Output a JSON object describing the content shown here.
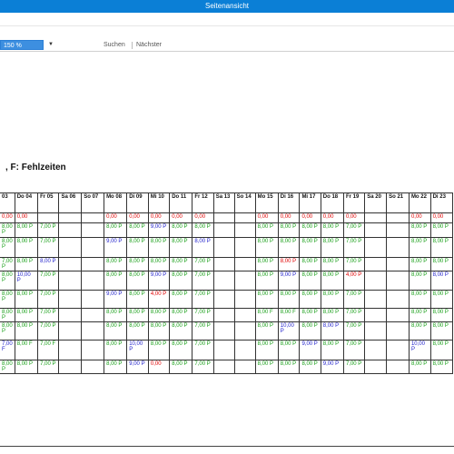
{
  "window": {
    "title": "Seitenansicht"
  },
  "toolbar": {
    "zoom": "150 %",
    "search_label": "Suchen",
    "next_label": "Nächster"
  },
  "report": {
    "heading": ", F: Fehlzeiten"
  },
  "colors": {
    "titlebar": "#0b7fd6",
    "zero": "#e00000",
    "normal": "#159e15",
    "blue": "#2222cc"
  },
  "table": {
    "headers": [
      "03",
      "Do 04",
      "Fr 05",
      "Sa 06",
      "So 07",
      "Mo 08",
      "Di 09",
      "Mi 10",
      "Do 11",
      "Fr 12",
      "Sa 13",
      "So 14",
      "Mo 15",
      "Di 16",
      "Mi 17",
      "Do 18",
      "Fr 19",
      "Sa 20",
      "So 21",
      "Mo 22",
      "Di 23"
    ],
    "rows": [
      [
        "0,00",
        "0,00",
        "",
        "",
        "",
        "0,00",
        "0,00",
        "0,00",
        "0,00",
        "0,00",
        "",
        "",
        "0,00",
        "0,00",
        "0,00",
        "0,00",
        "0,00",
        "",
        "",
        "0,00",
        "0,00"
      ],
      [
        "8,00 P",
        "8,00 P",
        "7,00 P",
        "",
        "",
        "8,00 P",
        "8,00 P",
        "9,00 P",
        "8,00 P",
        "8,00 P",
        "",
        "",
        "8,00 P",
        "8,00 P",
        "8,00 P",
        "8,00 P",
        "7,00 P",
        "",
        "",
        "8,00 P",
        "8,00 P"
      ],
      [
        "8,00 P",
        "8,00 P",
        "7,00 P",
        "",
        "",
        "9,00 P",
        "8,00 P",
        "8,00 P",
        "8,00 P",
        "8,00 P",
        "",
        "",
        "8,00 P",
        "8,00 P",
        "8,00 P",
        "8,00 P",
        "7,00 P",
        "",
        "",
        "8,00 P",
        "8,00 P"
      ],
      [
        "7,00 P",
        "8,00 P",
        "8,00 P",
        "",
        "",
        "8,00 P",
        "8,00 P",
        "8,00 P",
        "8,00 P",
        "7,00 P",
        "",
        "",
        "8,00 P",
        "8,00 P",
        "8,00 P",
        "8,00 P",
        "7,00 P",
        "",
        "",
        "8,00 P",
        "8,00 P"
      ],
      [
        "8,00 P",
        "10,00 P",
        "7,00 P",
        "",
        "",
        "8,00 P",
        "8,00 P",
        "9,00 P",
        "8,00 P",
        "7,00 P",
        "",
        "",
        "8,00 P",
        "9,00 P",
        "8,00 P",
        "8,00 P",
        "4,00 P",
        "",
        "",
        "8,00 P",
        "8,00 P"
      ],
      [
        "8,00 P",
        "8,00 P",
        "7,00 P",
        "",
        "",
        "9,00 P",
        "8,00 P",
        "4,00 P",
        "8,00 P",
        "7,00 P",
        "",
        "",
        "8,00 P",
        "8,00 P",
        "8,00 P",
        "8,00 P",
        "7,00 P",
        "",
        "",
        "8,00 P",
        "8,00 P"
      ],
      [
        "8,00 P",
        "8,00 P",
        "7,00 P",
        "",
        "",
        "8,00 P",
        "8,00 P",
        "8,00 P",
        "8,00 P",
        "7,00 P",
        "",
        "",
        "8,00 F",
        "8,00 F",
        "8,00 P",
        "8,00 P",
        "7,00 P",
        "",
        "",
        "8,00 P",
        "8,00 P"
      ],
      [
        "8,00 P",
        "8,00 P",
        "7,00 P",
        "",
        "",
        "8,00 P",
        "8,00 P",
        "8,00 P",
        "8,00 P",
        "7,00 P",
        "",
        "",
        "8,00 P",
        "10,00 P",
        "8,00 P",
        "8,00 P",
        "7,00 P",
        "",
        "",
        "8,00 P",
        "8,00 P"
      ],
      [
        "7,00 F",
        "8,00 F",
        "7,00 F",
        "",
        "",
        "8,00 P",
        "10,00 P",
        "8,00 P",
        "8,00 P",
        "7,00 P",
        "",
        "",
        "8,00 P",
        "8,00 P",
        "9,00 P",
        "8,00 P",
        "7,00 P",
        "",
        "",
        "10,00 P",
        "8,00 P"
      ],
      [
        "8,00 P",
        "8,00 P",
        "7,00 P",
        "",
        "",
        "8,00 P",
        "9,00 P",
        "0,00",
        "8,00 P",
        "7,00 P",
        "",
        "",
        "8,00 P",
        "8,00 P",
        "8,00 P",
        "9,00 P",
        "7,00 P",
        "",
        "",
        "8,00 P",
        "8,00 P"
      ]
    ],
    "row_colors": [
      [
        "red",
        "red",
        "",
        "",
        "",
        "red",
        "red",
        "red",
        "red",
        "red",
        "",
        "",
        "red",
        "red",
        "red",
        "red",
        "red",
        "",
        "",
        "red",
        "red"
      ],
      [
        "green",
        "green",
        "green",
        "",
        "",
        "green",
        "green",
        "blue",
        "green",
        "green",
        "",
        "",
        "green",
        "green",
        "green",
        "green",
        "green",
        "",
        "",
        "green",
        "green"
      ],
      [
        "green",
        "green",
        "green",
        "",
        "",
        "blue",
        "green",
        "green",
        "green",
        "blue",
        "",
        "",
        "green",
        "green",
        "green",
        "green",
        "green",
        "",
        "",
        "green",
        "green"
      ],
      [
        "green",
        "green",
        "blue",
        "",
        "",
        "green",
        "green",
        "green",
        "green",
        "green",
        "",
        "",
        "green",
        "red",
        "green",
        "green",
        "green",
        "",
        "",
        "green",
        "green"
      ],
      [
        "green",
        "blue",
        "green",
        "",
        "",
        "green",
        "green",
        "blue",
        "green",
        "green",
        "",
        "",
        "green",
        "blue",
        "green",
        "green",
        "red",
        "",
        "",
        "green",
        "blue"
      ],
      [
        "green",
        "green",
        "green",
        "",
        "",
        "blue",
        "green",
        "red",
        "green",
        "green",
        "",
        "",
        "green",
        "green",
        "green",
        "green",
        "green",
        "",
        "",
        "green",
        "green"
      ],
      [
        "green",
        "green",
        "green",
        "",
        "",
        "green",
        "green",
        "green",
        "green",
        "green",
        "",
        "",
        "green",
        "green",
        "green",
        "green",
        "green",
        "",
        "",
        "green",
        "green"
      ],
      [
        "green",
        "green",
        "green",
        "",
        "",
        "green",
        "green",
        "green",
        "green",
        "green",
        "",
        "",
        "green",
        "blue",
        "green",
        "blue",
        "green",
        "",
        "",
        "green",
        "green"
      ],
      [
        "blue",
        "green",
        "green",
        "",
        "",
        "green",
        "blue",
        "green",
        "green",
        "green",
        "",
        "",
        "green",
        "green",
        "blue",
        "green",
        "green",
        "",
        "",
        "blue",
        "green"
      ],
      [
        "green",
        "green",
        "green",
        "",
        "",
        "green",
        "blue",
        "red",
        "green",
        "green",
        "",
        "",
        "green",
        "green",
        "green",
        "blue",
        "green",
        "",
        "",
        "green",
        "green"
      ]
    ]
  }
}
